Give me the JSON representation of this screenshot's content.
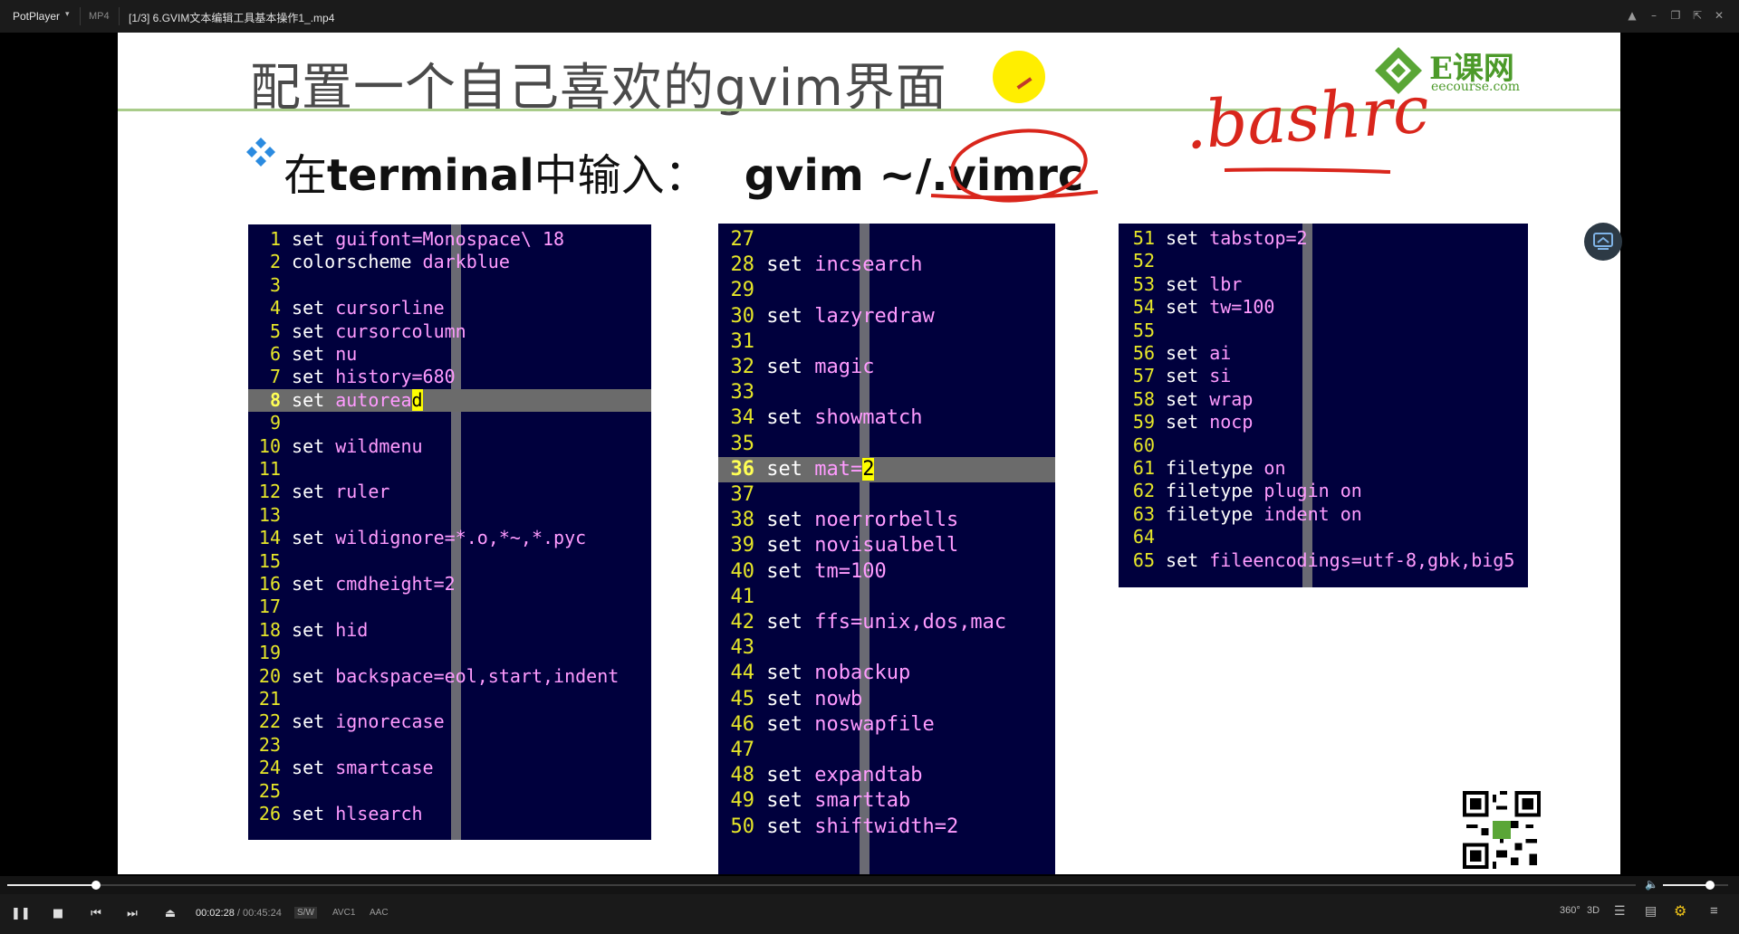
{
  "player": {
    "app_name": "PotPlayer",
    "format": "MP4",
    "file_title": "[1/3] 6.GVIM文本编辑工具基本操作1_.mp4"
  },
  "slide": {
    "title": "配置一个自己喜欢的gvim界面",
    "instruction_prefix": "在",
    "instruction_bold": "terminal",
    "instruction_suffix": "中输入：",
    "command": "gvim ~/.vimrc",
    "handwritten_note": ".bashrc",
    "logo_text": "E课网",
    "logo_url": "eecourse.com"
  },
  "terminals": [
    {
      "name": "vimrc-part-1",
      "lines": [
        {
          "n": "1",
          "kw": "set",
          "val": "guifont=Monospace\\ 18"
        },
        {
          "n": "2",
          "kw": "colorscheme",
          "val": "darkblue"
        },
        {
          "n": "3",
          "kw": "",
          "val": ""
        },
        {
          "n": "4",
          "kw": "set",
          "val": "cursorline"
        },
        {
          "n": "5",
          "kw": "set",
          "val": "cursorcolumn"
        },
        {
          "n": "6",
          "kw": "set",
          "val": "nu"
        },
        {
          "n": "7",
          "kw": "set",
          "val": "history=680"
        },
        {
          "n": "8",
          "kw": "set",
          "val": "autoread",
          "current": true
        },
        {
          "n": "9",
          "kw": "",
          "val": ""
        },
        {
          "n": "10",
          "kw": "set",
          "val": "wildmenu"
        },
        {
          "n": "11",
          "kw": "",
          "val": ""
        },
        {
          "n": "12",
          "kw": "set",
          "val": "ruler"
        },
        {
          "n": "13",
          "kw": "",
          "val": ""
        },
        {
          "n": "14",
          "kw": "set",
          "val": "wildignore=*.o,*~,*.pyc"
        },
        {
          "n": "15",
          "kw": "",
          "val": ""
        },
        {
          "n": "16",
          "kw": "set",
          "val": "cmdheight=2"
        },
        {
          "n": "17",
          "kw": "",
          "val": ""
        },
        {
          "n": "18",
          "kw": "set",
          "val": "hid"
        },
        {
          "n": "19",
          "kw": "",
          "val": ""
        },
        {
          "n": "20",
          "kw": "set",
          "val": "backspace=eol,start,indent"
        },
        {
          "n": "21",
          "kw": "",
          "val": ""
        },
        {
          "n": "22",
          "kw": "set",
          "val": "ignorecase"
        },
        {
          "n": "23",
          "kw": "",
          "val": ""
        },
        {
          "n": "24",
          "kw": "set",
          "val": "smartcase"
        },
        {
          "n": "25",
          "kw": "",
          "val": ""
        },
        {
          "n": "26",
          "kw": "set",
          "val": "hlsearch"
        }
      ]
    },
    {
      "name": "vimrc-part-2",
      "lines": [
        {
          "n": "27",
          "kw": "",
          "val": ""
        },
        {
          "n": "28",
          "kw": "set",
          "val": "incsearch"
        },
        {
          "n": "29",
          "kw": "",
          "val": ""
        },
        {
          "n": "30",
          "kw": "set",
          "val": "lazyredraw"
        },
        {
          "n": "31",
          "kw": "",
          "val": ""
        },
        {
          "n": "32",
          "kw": "set",
          "val": "magic"
        },
        {
          "n": "33",
          "kw": "",
          "val": ""
        },
        {
          "n": "34",
          "kw": "set",
          "val": "showmatch"
        },
        {
          "n": "35",
          "kw": "",
          "val": ""
        },
        {
          "n": "36",
          "kw": "set",
          "val": "mat=2",
          "current": true
        },
        {
          "n": "37",
          "kw": "",
          "val": ""
        },
        {
          "n": "38",
          "kw": "set",
          "val": "noerrorbells"
        },
        {
          "n": "39",
          "kw": "set",
          "val": "novisualbell"
        },
        {
          "n": "40",
          "kw": "set",
          "val": "tm=100"
        },
        {
          "n": "41",
          "kw": "",
          "val": ""
        },
        {
          "n": "42",
          "kw": "set",
          "val": "ffs=unix,dos,mac"
        },
        {
          "n": "43",
          "kw": "",
          "val": ""
        },
        {
          "n": "44",
          "kw": "set",
          "val": "nobackup"
        },
        {
          "n": "45",
          "kw": "set",
          "val": "nowb"
        },
        {
          "n": "46",
          "kw": "set",
          "val": "noswapfile"
        },
        {
          "n": "47",
          "kw": "",
          "val": ""
        },
        {
          "n": "48",
          "kw": "set",
          "val": "expandtab"
        },
        {
          "n": "49",
          "kw": "set",
          "val": "smarttab"
        },
        {
          "n": "50",
          "kw": "set",
          "val": "shiftwidth=2"
        }
      ]
    },
    {
      "name": "vimrc-part-3",
      "lines": [
        {
          "n": "51",
          "kw": "set",
          "val": "tabstop=2"
        },
        {
          "n": "52",
          "kw": "",
          "val": ""
        },
        {
          "n": "53",
          "kw": "set",
          "val": "lbr"
        },
        {
          "n": "54",
          "kw": "set",
          "val": "tw=100"
        },
        {
          "n": "55",
          "kw": "",
          "val": ""
        },
        {
          "n": "56",
          "kw": "set",
          "val": "ai"
        },
        {
          "n": "57",
          "kw": "set",
          "val": "si"
        },
        {
          "n": "58",
          "kw": "set",
          "val": "wrap"
        },
        {
          "n": "59",
          "kw": "set",
          "val": "nocp"
        },
        {
          "n": "60",
          "kw": "",
          "val": ""
        },
        {
          "n": "61",
          "kw": "filetype",
          "val": "on"
        },
        {
          "n": "62",
          "kw": "filetype",
          "val": "plugin on"
        },
        {
          "n": "63",
          "kw": "filetype",
          "val": "indent on"
        },
        {
          "n": "64",
          "kw": "",
          "val": ""
        },
        {
          "n": "65",
          "kw": "set",
          "val": "fileencodings=utf-8,gbk,big5"
        }
      ]
    }
  ],
  "controls": {
    "current_time": "00:02:28",
    "separator": "/",
    "duration": "00:45:24",
    "progress": 0.0543,
    "volume": 0.72,
    "tag_sw": "S/W",
    "tag_video": "AVC1",
    "tag_audio": "AAC",
    "label_360": "360°",
    "label_3d": "3D"
  },
  "colors": {
    "terminal_bg": "#00003d",
    "line_number": "#e6e629",
    "keyword": "#ffffff",
    "value": "#ff9bff",
    "title_rule": "#a9cc8a",
    "annotation_red": "#d9261c"
  },
  "icons": [
    "menu-chevron-icon",
    "pin-icon",
    "minimize-icon",
    "restore-icon",
    "fullscreen-icon",
    "close-icon",
    "pause-icon",
    "stop-icon",
    "prev-icon",
    "next-icon",
    "eject-icon",
    "volume-icon",
    "playlist-icon",
    "subtitle-icon",
    "settings-icon",
    "menu-icon",
    "share-icon"
  ]
}
